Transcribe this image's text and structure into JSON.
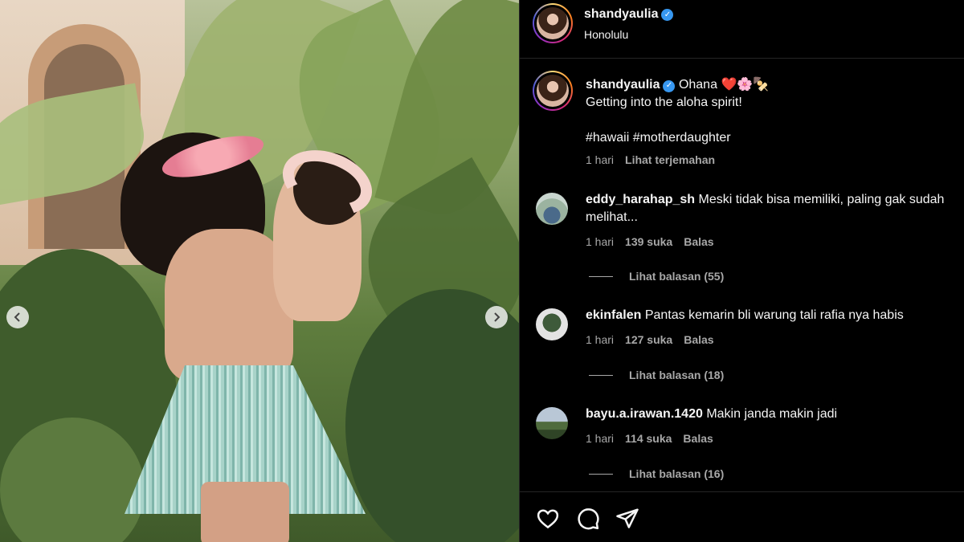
{
  "post": {
    "username": "shandyaulia",
    "location": "Honolulu"
  },
  "caption": {
    "username": "shandyaulia",
    "line1": "Ohana",
    "emojis": "❤️🌸🍢",
    "line2": "Getting into the aloha spirit!",
    "hashtags": "#hawaii #motherdaughter",
    "time": "1 hari",
    "translate": "Lihat terjemahan"
  },
  "comments": [
    {
      "username": "eddy_harahap_sh",
      "text": "Meski tidak bisa memiliki, paling gak sudah melihat...",
      "time": "1 hari",
      "likes": "139 suka",
      "reply": "Balas",
      "view_replies": "Lihat balasan (55)"
    },
    {
      "username": "ekinfalen",
      "text": "Pantas kemarin bli warung tali rafia nya habis",
      "time": "1 hari",
      "likes": "127 suka",
      "reply": "Balas",
      "view_replies": "Lihat balasan (18)"
    },
    {
      "username": "bayu.a.irawan.1420",
      "text": "Makin janda makin jadi",
      "time": "1 hari",
      "likes": "114 suka",
      "reply": "Balas",
      "view_replies": "Lihat balasan (16)"
    }
  ],
  "nav": {
    "prev_icon": "chevron-left-icon",
    "next_icon": "chevron-right-icon"
  },
  "actions": {
    "like_icon": "heart-icon",
    "comment_icon": "comment-icon",
    "share_icon": "send-icon"
  },
  "colors": {
    "verified": "#3797f0",
    "muted": "#a8a8a8",
    "background": "#000000"
  }
}
